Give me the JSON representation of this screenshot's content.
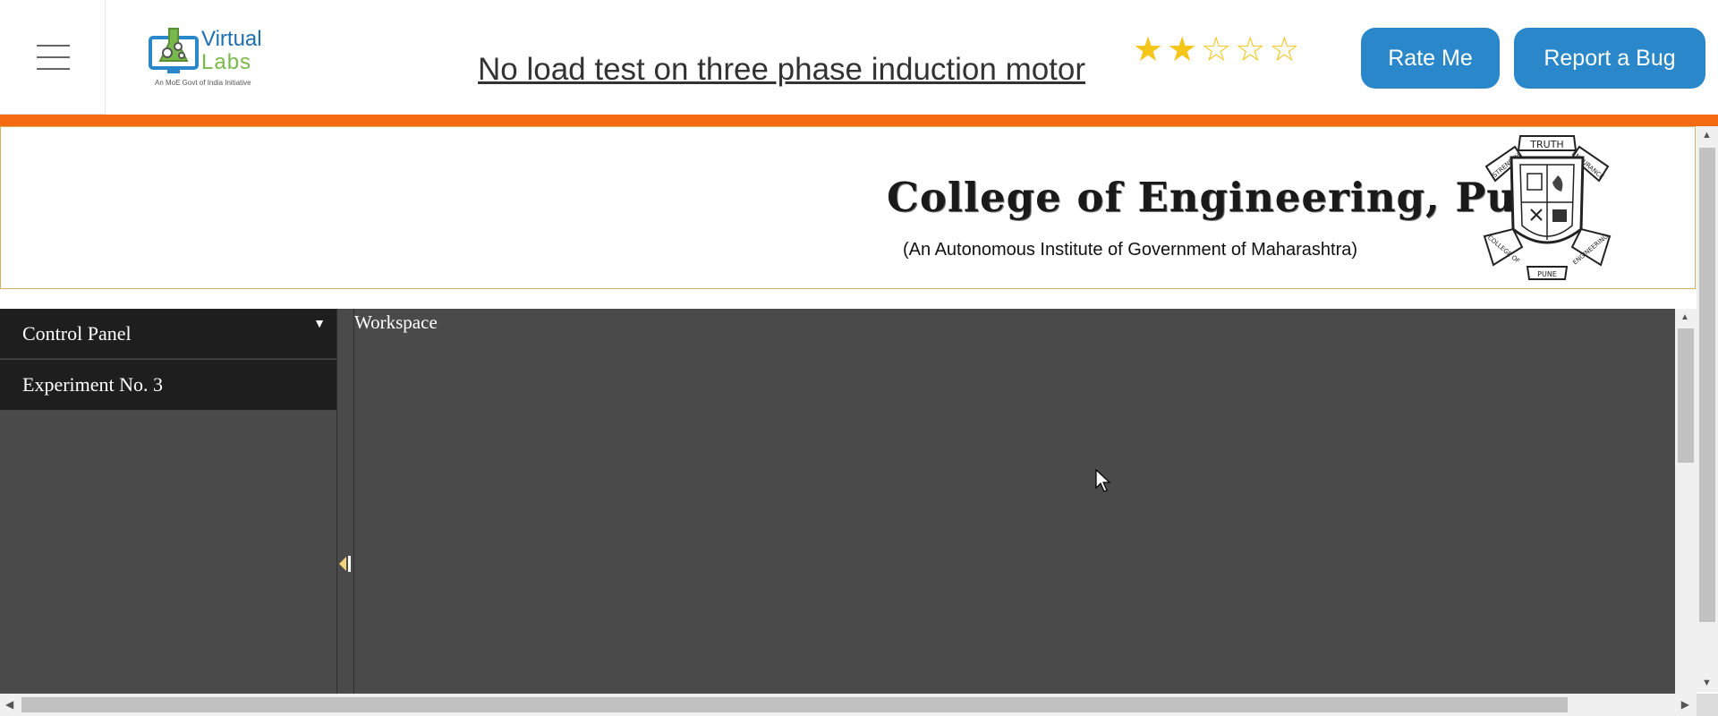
{
  "header": {
    "logo": {
      "word1": "Virtual",
      "word2": "Labs",
      "tagline": "An MoE Govt of India Initiative"
    },
    "title": "No load test on three phase induction motor",
    "rating": {
      "value": 2,
      "max": 5
    },
    "rate_button": "Rate Me",
    "bug_button": "Report a Bug",
    "accent_color": "#f36a10",
    "button_color": "#2a87c9"
  },
  "banner": {
    "college_name": "College of Engineering, Pune",
    "college_subtitle": "(An Autonomous Institute of Government of Maharashtra)",
    "crest": {
      "top_text": "TRUTH",
      "left_text": "STRENGTH",
      "right_text": "ENDURANCE",
      "bottom_left_text": "COLLEGE OF",
      "bottom_right_text": "ENGINEERING",
      "bottom_text": "PUNE"
    }
  },
  "sidebar": {
    "control_panel_label": "Control Panel",
    "experiment_label": "Experiment No. 3"
  },
  "workspace": {
    "label": "Workspace"
  }
}
